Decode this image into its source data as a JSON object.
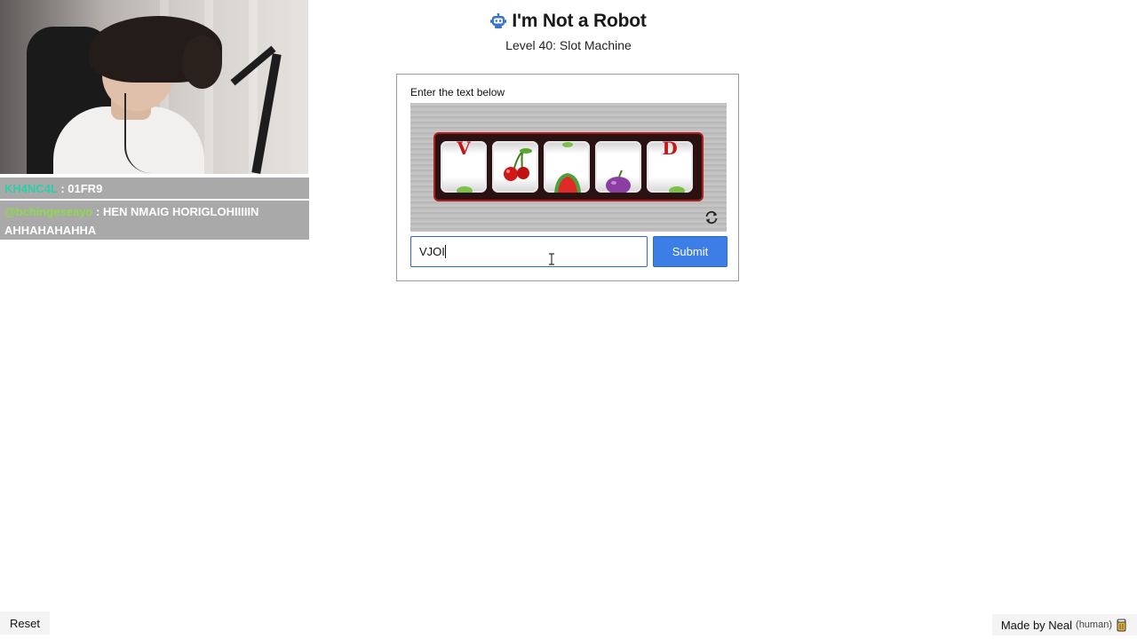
{
  "app": {
    "title": "I'm Not a Robot",
    "title_icon": "robot-icon",
    "subtitle": "Level 40: Slot Machine"
  },
  "captcha": {
    "label": "Enter the text below",
    "reels": [
      {
        "letter": "V",
        "icon": "letter-v-reel"
      },
      {
        "letter": "",
        "icon": "cherry-reel"
      },
      {
        "letter": "",
        "icon": "watermelon-reel"
      },
      {
        "letter": "",
        "icon": "plum-reel"
      },
      {
        "letter": "D",
        "icon": "letter-d-reel"
      }
    ],
    "refresh_icon": "refresh-icon",
    "input_value": "VJOI",
    "submit_label": "Submit"
  },
  "footer": {
    "reset_label": "Reset",
    "credit_text": "Made by Neal",
    "credit_note": "(human)",
    "credit_icon": "beer-icon"
  },
  "stream_overlay": {
    "chat": [
      {
        "user": "KH4NC4L",
        "separator": " : ",
        "message": "01FR9"
      },
      {
        "user": "@bchingeseayo",
        "separator": " : ",
        "message": "HEN NMAIG HORIGLOHIIIIIN AHHAHAHAHHA"
      }
    ]
  },
  "colors": {
    "accent": "#3c7de6",
    "reel_letter": "#c31818",
    "slot_frame": "#b01d1d"
  }
}
